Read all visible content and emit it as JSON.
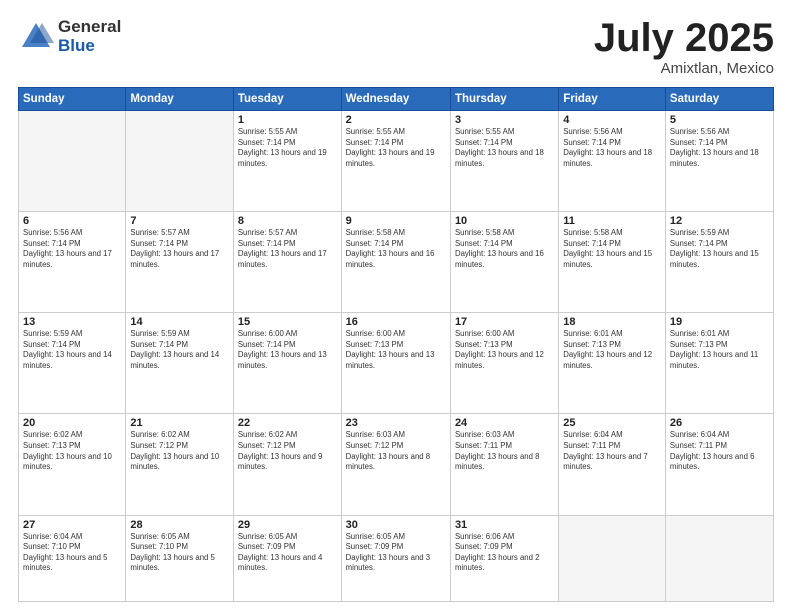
{
  "header": {
    "logo_general": "General",
    "logo_blue": "Blue",
    "month_title": "July 2025",
    "location": "Amixtlan, Mexico"
  },
  "weekdays": [
    "Sunday",
    "Monday",
    "Tuesday",
    "Wednesday",
    "Thursday",
    "Friday",
    "Saturday"
  ],
  "weeks": [
    [
      {
        "day": "",
        "empty": true
      },
      {
        "day": "",
        "empty": true
      },
      {
        "day": "1",
        "sunrise": "Sunrise: 5:55 AM",
        "sunset": "Sunset: 7:14 PM",
        "daylight": "Daylight: 13 hours and 19 minutes."
      },
      {
        "day": "2",
        "sunrise": "Sunrise: 5:55 AM",
        "sunset": "Sunset: 7:14 PM",
        "daylight": "Daylight: 13 hours and 19 minutes."
      },
      {
        "day": "3",
        "sunrise": "Sunrise: 5:55 AM",
        "sunset": "Sunset: 7:14 PM",
        "daylight": "Daylight: 13 hours and 18 minutes."
      },
      {
        "day": "4",
        "sunrise": "Sunrise: 5:56 AM",
        "sunset": "Sunset: 7:14 PM",
        "daylight": "Daylight: 13 hours and 18 minutes."
      },
      {
        "day": "5",
        "sunrise": "Sunrise: 5:56 AM",
        "sunset": "Sunset: 7:14 PM",
        "daylight": "Daylight: 13 hours and 18 minutes."
      }
    ],
    [
      {
        "day": "6",
        "sunrise": "Sunrise: 5:56 AM",
        "sunset": "Sunset: 7:14 PM",
        "daylight": "Daylight: 13 hours and 17 minutes."
      },
      {
        "day": "7",
        "sunrise": "Sunrise: 5:57 AM",
        "sunset": "Sunset: 7:14 PM",
        "daylight": "Daylight: 13 hours and 17 minutes."
      },
      {
        "day": "8",
        "sunrise": "Sunrise: 5:57 AM",
        "sunset": "Sunset: 7:14 PM",
        "daylight": "Daylight: 13 hours and 17 minutes."
      },
      {
        "day": "9",
        "sunrise": "Sunrise: 5:58 AM",
        "sunset": "Sunset: 7:14 PM",
        "daylight": "Daylight: 13 hours and 16 minutes."
      },
      {
        "day": "10",
        "sunrise": "Sunrise: 5:58 AM",
        "sunset": "Sunset: 7:14 PM",
        "daylight": "Daylight: 13 hours and 16 minutes."
      },
      {
        "day": "11",
        "sunrise": "Sunrise: 5:58 AM",
        "sunset": "Sunset: 7:14 PM",
        "daylight": "Daylight: 13 hours and 15 minutes."
      },
      {
        "day": "12",
        "sunrise": "Sunrise: 5:59 AM",
        "sunset": "Sunset: 7:14 PM",
        "daylight": "Daylight: 13 hours and 15 minutes."
      }
    ],
    [
      {
        "day": "13",
        "sunrise": "Sunrise: 5:59 AM",
        "sunset": "Sunset: 7:14 PM",
        "daylight": "Daylight: 13 hours and 14 minutes."
      },
      {
        "day": "14",
        "sunrise": "Sunrise: 5:59 AM",
        "sunset": "Sunset: 7:14 PM",
        "daylight": "Daylight: 13 hours and 14 minutes."
      },
      {
        "day": "15",
        "sunrise": "Sunrise: 6:00 AM",
        "sunset": "Sunset: 7:14 PM",
        "daylight": "Daylight: 13 hours and 13 minutes."
      },
      {
        "day": "16",
        "sunrise": "Sunrise: 6:00 AM",
        "sunset": "Sunset: 7:13 PM",
        "daylight": "Daylight: 13 hours and 13 minutes."
      },
      {
        "day": "17",
        "sunrise": "Sunrise: 6:00 AM",
        "sunset": "Sunset: 7:13 PM",
        "daylight": "Daylight: 13 hours and 12 minutes."
      },
      {
        "day": "18",
        "sunrise": "Sunrise: 6:01 AM",
        "sunset": "Sunset: 7:13 PM",
        "daylight": "Daylight: 13 hours and 12 minutes."
      },
      {
        "day": "19",
        "sunrise": "Sunrise: 6:01 AM",
        "sunset": "Sunset: 7:13 PM",
        "daylight": "Daylight: 13 hours and 11 minutes."
      }
    ],
    [
      {
        "day": "20",
        "sunrise": "Sunrise: 6:02 AM",
        "sunset": "Sunset: 7:13 PM",
        "daylight": "Daylight: 13 hours and 10 minutes."
      },
      {
        "day": "21",
        "sunrise": "Sunrise: 6:02 AM",
        "sunset": "Sunset: 7:12 PM",
        "daylight": "Daylight: 13 hours and 10 minutes."
      },
      {
        "day": "22",
        "sunrise": "Sunrise: 6:02 AM",
        "sunset": "Sunset: 7:12 PM",
        "daylight": "Daylight: 13 hours and 9 minutes."
      },
      {
        "day": "23",
        "sunrise": "Sunrise: 6:03 AM",
        "sunset": "Sunset: 7:12 PM",
        "daylight": "Daylight: 13 hours and 8 minutes."
      },
      {
        "day": "24",
        "sunrise": "Sunrise: 6:03 AM",
        "sunset": "Sunset: 7:11 PM",
        "daylight": "Daylight: 13 hours and 8 minutes."
      },
      {
        "day": "25",
        "sunrise": "Sunrise: 6:04 AM",
        "sunset": "Sunset: 7:11 PM",
        "daylight": "Daylight: 13 hours and 7 minutes."
      },
      {
        "day": "26",
        "sunrise": "Sunrise: 6:04 AM",
        "sunset": "Sunset: 7:11 PM",
        "daylight": "Daylight: 13 hours and 6 minutes."
      }
    ],
    [
      {
        "day": "27",
        "sunrise": "Sunrise: 6:04 AM",
        "sunset": "Sunset: 7:10 PM",
        "daylight": "Daylight: 13 hours and 5 minutes."
      },
      {
        "day": "28",
        "sunrise": "Sunrise: 6:05 AM",
        "sunset": "Sunset: 7:10 PM",
        "daylight": "Daylight: 13 hours and 5 minutes."
      },
      {
        "day": "29",
        "sunrise": "Sunrise: 6:05 AM",
        "sunset": "Sunset: 7:09 PM",
        "daylight": "Daylight: 13 hours and 4 minutes."
      },
      {
        "day": "30",
        "sunrise": "Sunrise: 6:05 AM",
        "sunset": "Sunset: 7:09 PM",
        "daylight": "Daylight: 13 hours and 3 minutes."
      },
      {
        "day": "31",
        "sunrise": "Sunrise: 6:06 AM",
        "sunset": "Sunset: 7:09 PM",
        "daylight": "Daylight: 13 hours and 2 minutes."
      },
      {
        "day": "",
        "empty": true
      },
      {
        "day": "",
        "empty": true
      }
    ]
  ]
}
